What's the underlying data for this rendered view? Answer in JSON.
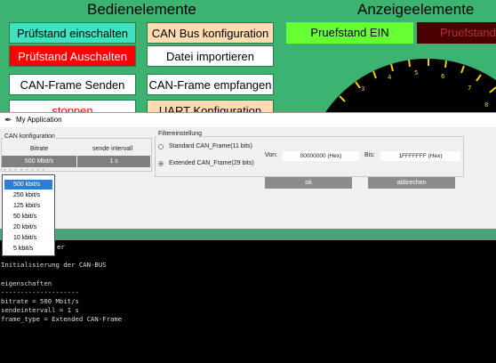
{
  "headers": {
    "controls": "Bedienelemente",
    "displays": "Anzeigeelemente"
  },
  "buttons": {
    "pruefstand_ein": "Prüfstand einschalten",
    "pruefstand_aus": "Prüfstand Auschalten",
    "can_frame_senden": "CAN-Frame Senden",
    "stoppen": "stoppen",
    "can_bus_konfig": "CAN Bus konfiguration",
    "datei_importieren": "Datei importieren",
    "can_frame_empfangen": "CAN-Frame empfangen",
    "uart_konfig": "UART Konfiguration"
  },
  "indicators": {
    "status_on": "Pruefstand EIN",
    "status_off": "Pruefstand"
  },
  "gauge": {
    "ticks": [
      "3",
      "4",
      "5",
      "6",
      "7",
      "8"
    ]
  },
  "colors": {
    "background": "#3cb371",
    "on": "#66ff33",
    "off": "#4a0000",
    "red_button": "#ff0000",
    "teal_button": "#40e0c0"
  },
  "dialog": {
    "title": "My Application",
    "can_group": "CAN konfiguration",
    "col_bitrate": "Bitrate",
    "col_interval": "sende intervall",
    "bitrate_value": "500 Mbit/s",
    "interval_value": "1 s",
    "filter_group": "Filtereinstellung",
    "radio_standard": "Standard CAN_Frame(11 bits)",
    "radio_extended": "Extended CAN_Frame(29 bits)",
    "von_label": "Von:",
    "von_value": "00000000 (Hex)",
    "bis_label": "Bis:",
    "bis_value": "1FFFFFFF (Hex)",
    "ok": "ok",
    "cancel": "abbrechen"
  },
  "dropdown": {
    "dashes": "- - - - - - - -",
    "items": [
      "500 kbit/s",
      "250 kbit/s",
      "125 kbit/s",
      "50 kbit/s",
      "20 kbit/s",
      "10 kbit/s",
      "5 kbit/s"
    ],
    "selected": 0
  },
  "console": {
    "lines": [
      "er",
      "Initialisierung der CAN-BUS",
      "",
      "eigenschaften",
      "--------------------",
      "bitrate = 500 Mbit/s",
      "sendeintervall = 1 s",
      "frame_type = Extended CAN-Frame"
    ]
  }
}
